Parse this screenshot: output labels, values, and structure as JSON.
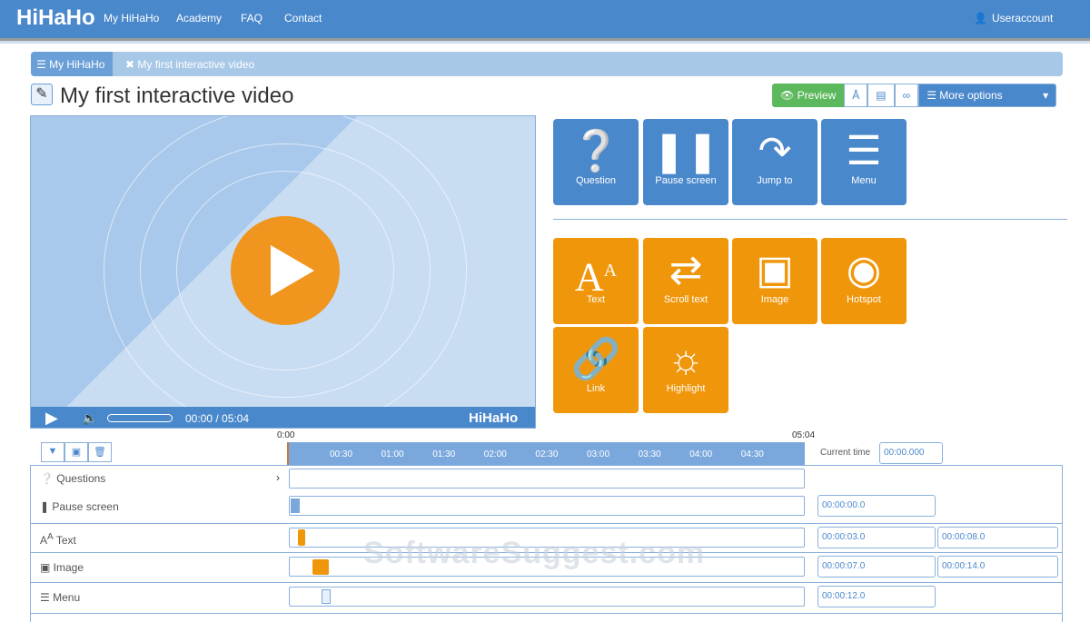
{
  "nav": {
    "logo": "HiHaHo",
    "links": [
      "My HiHaHo",
      "Academy",
      "FAQ",
      "Contact"
    ],
    "account": "Useraccount"
  },
  "breadcrumb": [
    "My HiHaHo",
    "My first interactive video"
  ],
  "title": "My first interactive video",
  "toolbar": {
    "preview": "Preview",
    "more": "More options"
  },
  "player": {
    "time": "00:00 / 05:04",
    "logo": "HiHaHo"
  },
  "tiles_blue": [
    "Question",
    "Pause screen",
    "Jump to",
    "Menu"
  ],
  "tiles_orange": [
    "Text",
    "Scroll text",
    "Image",
    "Hotspot",
    "Link",
    "Highlight"
  ],
  "timeline": {
    "start": "0:00",
    "end": "05:04",
    "ticks": [
      "00:30",
      "01:00",
      "01:30",
      "02:00",
      "02:30",
      "03:00",
      "03:30",
      "04:00",
      "04:30"
    ],
    "current_time_label": "Current time",
    "current_time": "00:00.000",
    "rows": [
      {
        "label": "Questions",
        "times": []
      },
      {
        "label": "Pause screen",
        "times": [
          "00:00:00.0"
        ]
      },
      {
        "label": "Text",
        "times": [
          "00:00:03.0",
          "00:00:08.0"
        ]
      },
      {
        "label": "Image",
        "times": [
          "00:00:07.0",
          "00:00:14.0"
        ]
      },
      {
        "label": "Menu",
        "times": [
          "00:00:12.0"
        ]
      }
    ]
  },
  "watermark": "SoftwareSuggest.com"
}
